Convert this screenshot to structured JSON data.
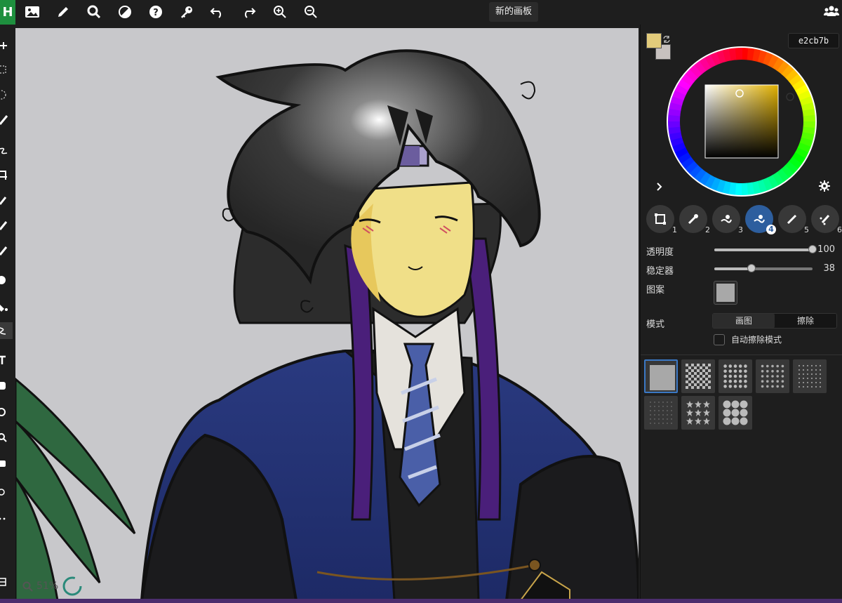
{
  "app": {
    "logo_letter": "H"
  },
  "document": {
    "title": "新的画板"
  },
  "color": {
    "primary": "#e2cb7b",
    "secondary": "#c7c1bf",
    "hex": "e2cb7b"
  },
  "brushes": [
    {
      "num": "1",
      "icon": "pen-bounding-icon",
      "active": false
    },
    {
      "num": "2",
      "icon": "eyedropper-icon",
      "active": false
    },
    {
      "num": "3",
      "icon": "blend-brush-icon",
      "active": false
    },
    {
      "num": "4",
      "icon": "blend-brush-icon",
      "active": true
    },
    {
      "num": "5",
      "icon": "brush-icon",
      "active": false
    },
    {
      "num": "6",
      "icon": "splatter-brush-icon",
      "active": false
    }
  ],
  "settings": {
    "opacity_label": "透明度",
    "opacity_value": "100",
    "opacity_level": 1.0,
    "stabilizer_label": "稳定器",
    "stabilizer_value": "38",
    "stabilizer_level": 0.38,
    "pattern_label": "图案",
    "mode_label": "模式",
    "mode_draw": "画图",
    "mode_erase": "擦除",
    "auto_erase_label": "自动擦除模式"
  },
  "zoom": {
    "label": "51%"
  },
  "pattern_presets": [
    "solid",
    "checker",
    "dots-large",
    "dots-medium",
    "dots-small",
    "dots-tiny",
    "stars",
    "circles"
  ]
}
